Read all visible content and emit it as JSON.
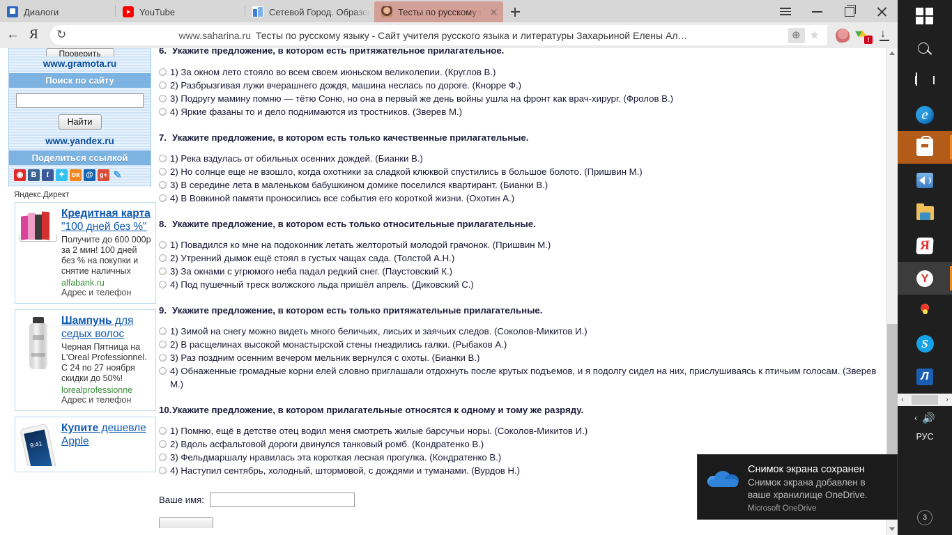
{
  "browser": {
    "tabs": [
      {
        "title": "Диалоги",
        "icon": "dialogs-favicon",
        "active": false
      },
      {
        "title": "YouTube",
        "icon": "youtube-favicon",
        "active": false
      },
      {
        "title": "Сетевой Город. Образован",
        "icon": "sgo-favicon",
        "active": false
      },
      {
        "title": "Тесты по русскому язык",
        "icon": "saharina-favicon",
        "active": true
      }
    ],
    "new_tab_label": "+",
    "window_controls": [
      "menu-icon",
      "minimize-icon",
      "restore-icon",
      "close-icon"
    ],
    "address": {
      "domain": "www.saharina.ru",
      "page_title": "Тесты по русскому языку - Сайт учителя русского языка и литературы Захарьиной Елены Ал…",
      "back_icon": "back-arrow-icon",
      "yandex_icon": "yandex-logo-icon",
      "reload_icon": "reload-icon",
      "translate_icon": "translate-icon",
      "bookmark_icon": "star-icon"
    },
    "extensions": [
      {
        "name": "worm-extension-icon",
        "badge": ""
      },
      {
        "name": "adguard-extension-icon",
        "badge": "!"
      },
      {
        "name": "downloads-icon",
        "badge": ""
      }
    ]
  },
  "sidebar": {
    "clipped_button_label": "Проверить",
    "gramota_link": "www.gramota.ru",
    "search_heading": "Поиск по сайту",
    "search_value": "",
    "find_button": "Найти",
    "yandex_link": "www.yandex.ru",
    "share_heading": "Поделиться ссылкой",
    "share_icons": [
      "livejournal-share-icon",
      "vk-share-icon",
      "facebook-share-icon",
      "twitter-share-icon",
      "odnoklassniki-share-icon",
      "mailru-share-icon",
      "googleplus-share-icon",
      "more-share-icon"
    ],
    "share_glyphs": [
      "",
      "B",
      "f",
      "",
      "ок",
      "@",
      "g+",
      "✎"
    ],
    "direct_label": "Яндекс.Директ",
    "ads": [
      {
        "thumb": "credit-cards-thumb",
        "title_bold": "Кредитная карта",
        "title_rest": " \"100 дней без %\"",
        "text": "Получите до 600 000р за 2 мин! 100 дней без % на покупки и снятие наличных",
        "url": "alfabank.ru",
        "addr": "Адрес и телефон"
      },
      {
        "thumb": "shampoo-bottle-thumb",
        "title_bold": "Шампунь",
        "title_rest": " для седых волос",
        "text": "Черная Пятница на L'Oreal Professionnel. С 24 по 27 ноября скидки до 50%!",
        "url": "lorealprofessionne",
        "addr": "Адрес и телефон"
      },
      {
        "thumb": "iphone-thumb",
        "title_bold": "Купите",
        "title_rest": " дешевле Apple",
        "text": "",
        "url": "",
        "addr": ""
      }
    ]
  },
  "quiz": {
    "questions": [
      {
        "number": "6.",
        "text": "Укажите предложение, в котором есть притяжательное прилагательное.",
        "clipped": true,
        "options": [
          "1) За окном лето стояло во всем своем июньском великолепии. (Круглов В.)",
          "2) Разбрызгивая лужи вчерашнего дождя, машина неслась по дороге. (Кнорре Ф.)",
          "3) Подругу мамину помню — тётю Соню, но она в первый же день войны ушла на фронт как врач-хирург. (Фролов В.)",
          "4) Яркие фазаны то и дело поднимаются из тростников. (Зверев М.)"
        ]
      },
      {
        "number": "7.",
        "text": "Укажите предложение, в котором есть только качественные прилагательные.",
        "clipped": false,
        "options": [
          "1) Река вздулась от обильных осенних дождей. (Бианки В.)",
          "2) Но солнце еще не взошло, когда охотники за сладкой клюквой спустились в большое болото. (Пришвин М.)",
          "3) В середине лета в маленьком бабушкином домике поселился квартирант. (Бианки В.)",
          "4) В Вовкиной памяти проносились все события его короткой жизни. (Охотин А.)"
        ]
      },
      {
        "number": "8.",
        "text": "Укажите предложение, в котором есть только относительные прилагательные.",
        "clipped": false,
        "options": [
          "1) Повадился ко мне на подоконник летать желторотый молодой грачонок. (Пришвин М.)",
          "2) Утренний дымок ещё стоял в густых чащах сада. (Толстой А.Н.)",
          "3) За окнами с угрюмого неба падал редкий снег. (Паустовский К.)",
          "4) Под пушечный треск волжского льда пришёл апрель. (Диковский С.)"
        ]
      },
      {
        "number": "9.",
        "text": "Укажите предложение, в котором есть только притяжательные прилагательные.",
        "clipped": false,
        "options": [
          "1) Зимой на снегу можно видеть много беличьих, лисьих и заячьих следов. (Соколов-Микитов И.)",
          "2) В расщелинах высокой монастырской стены гнездились галки. (Рыбаков А.)",
          "3) Раз поздним осенним вечером мельник вернулся с охоты. (Бианки В.)",
          "4) Обнаженные громадные корни елей словно приглашали отдохнуть после крутых подъемов, и я подолгу сидел на них, прислушиваясь к птичьим голосам. (Зверев М.)"
        ]
      },
      {
        "number": "10.",
        "text": "Укажите предложение, в котором прилагательные относятся к одному и тому же разряду.",
        "clipped": false,
        "options": [
          "1) Помню, ещё в детстве отец водил меня смотреть жилые барсучьи норы. (Соколов-Микитов И.)",
          "2) Вдоль асфальтовой дороги двинулся танковый ромб. (Кондратенко В.)",
          "3) Фельдмаршалу нравилась эта короткая лесная прогулка. (Кондратенко В.)",
          "4) Наступил сентябрь, холодный, штормовой, с дождями и туманами. (Вурдов Н.)"
        ]
      }
    ],
    "name_label": "Ваше имя:",
    "name_value": ""
  },
  "taskbar": {
    "items": [
      {
        "name": "start-button",
        "icon": "windows-logo-icon",
        "state": "normal"
      },
      {
        "name": "search-button",
        "icon": "search-icon",
        "state": "normal"
      },
      {
        "name": "task-view-button",
        "icon": "task-view-icon",
        "state": "normal"
      },
      {
        "name": "edge-button",
        "icon": "edge-icon",
        "state": "normal"
      },
      {
        "name": "store-button",
        "icon": "microsoft-store-icon",
        "state": "highlight"
      },
      {
        "name": "volume-app-button",
        "icon": "speaker-icon",
        "state": "normal"
      },
      {
        "name": "file-explorer-button",
        "icon": "folder-icon",
        "state": "normal"
      },
      {
        "name": "yandex-browser-button",
        "icon": "yandex-browser-icon",
        "state": "normal"
      },
      {
        "name": "yandex-app-button",
        "icon": "yandex-circle-icon",
        "state": "running"
      },
      {
        "name": "antivirus-button",
        "icon": "flower-icon",
        "state": "normal"
      },
      {
        "name": "skype-button",
        "icon": "skype-icon",
        "state": "normal"
      },
      {
        "name": "app-button",
        "icon": "blue-app-icon",
        "state": "normal"
      }
    ],
    "scroll_left": "‹",
    "scroll_right": "›",
    "tray_chevron": "‹",
    "tray_volume": "🔊",
    "language": "РУС",
    "clock_badge": "3"
  },
  "toast": {
    "icon": "onedrive-cloud-icon",
    "title": "Снимок экрана сохранен",
    "text": "Снимок экрана добавлен в ваше хранилище OneDrive.",
    "app": "Microsoft OneDrive"
  },
  "colors": {
    "active_tab": "#d2a096",
    "taskbar_bg": "#1f1f1f",
    "taskbar_highlight": "#b35b18",
    "accent_link": "#0d58b0",
    "sidebar_header": "#7cb3e0"
  }
}
